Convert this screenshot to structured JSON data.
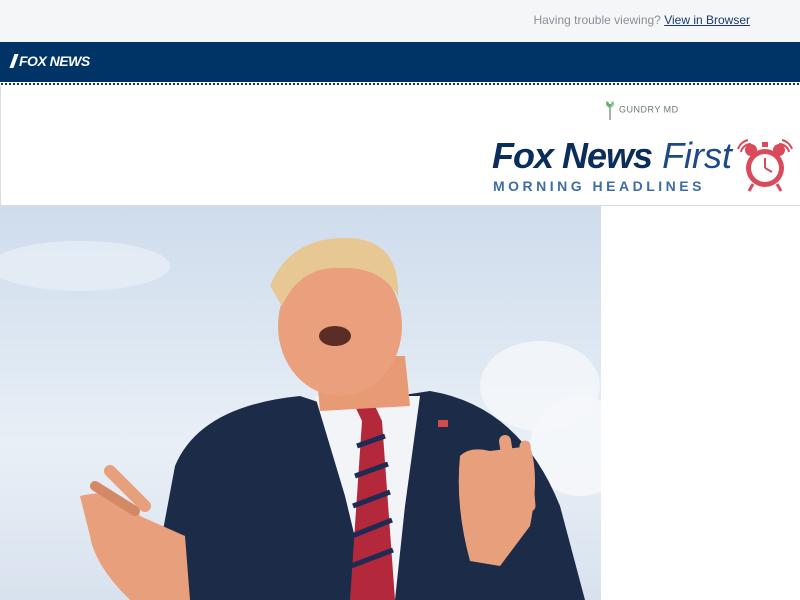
{
  "top_bar": {
    "trouble_text": "Having trouble viewing?",
    "view_in_browser": "View in Browser"
  },
  "brand": {
    "logo_text": "FOX NEWS"
  },
  "header": {
    "sponsor_text": "GUNDRY MD",
    "title_bold": "Fox News",
    "title_light": "First",
    "subtitle": "MORNING HEADLINES"
  },
  "colors": {
    "navy": "#003366",
    "title_navy": "#0b2d5c",
    "subtitle_blue": "#3d6ea3",
    "alarm_red": "#d94b5a"
  },
  "icons": {
    "logo": "fox-news-logo",
    "sponsor": "leaf-icon",
    "alarm": "alarm-clock-icon",
    "hero": "hero-photo"
  }
}
